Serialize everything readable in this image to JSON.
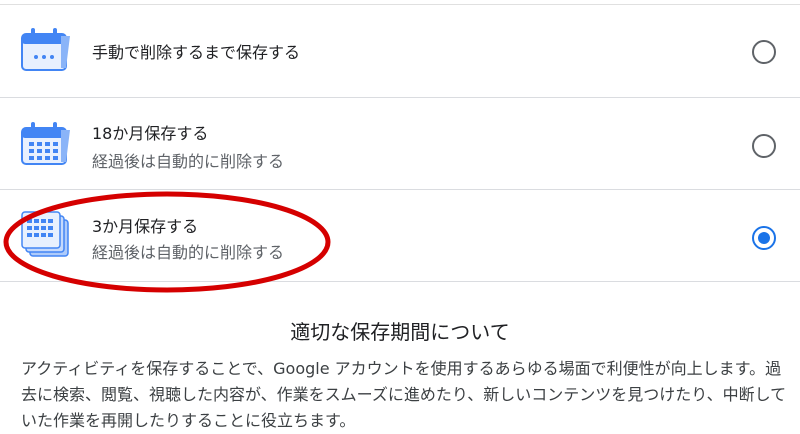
{
  "options": [
    {
      "title": "手動で削除するまで保存する",
      "subtitle": "",
      "icon": "calendar-dots-icon",
      "selected": false
    },
    {
      "title": "18か月保存する",
      "subtitle": "経過後は自動的に削除する",
      "icon": "calendar-grid-icon",
      "selected": false
    },
    {
      "title": "3か月保存する",
      "subtitle": "経過後は自動的に削除する",
      "icon": "calendar-stack-icon",
      "selected": true
    }
  ],
  "info": {
    "title": "適切な保存期間について",
    "body": "アクティビティを保存することで、Google アカウントを使用するあらゆる場面で利便性が向上します。過去に検索、閲覧、視聴した内容が、作業をスムーズに進めたり、新しいコンテンツを見つけたり、中断していた作業を再開したりすることに役立ちます。"
  },
  "colors": {
    "accent": "#1a73e8",
    "icon_blue": "#4285f4",
    "highlight": "#d50000"
  }
}
